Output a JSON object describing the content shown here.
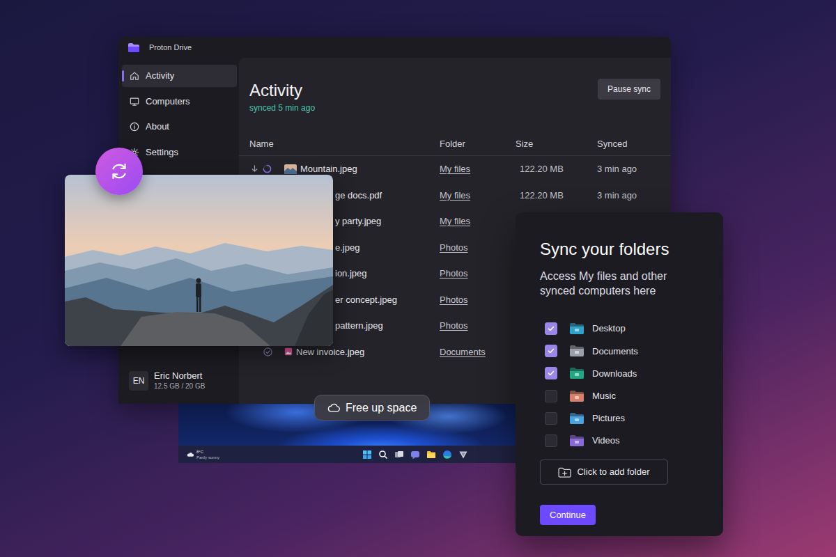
{
  "window": {
    "title": "Proton Drive"
  },
  "sidebar": {
    "items": [
      {
        "label": "Activity",
        "selected": true
      },
      {
        "label": "Computers",
        "selected": false
      },
      {
        "label": "About",
        "selected": false
      },
      {
        "label": "Settings",
        "selected": false
      }
    ],
    "user": {
      "initials": "EN",
      "name": "Eric Norbert",
      "storage": "12.5 GB / 20 GB"
    }
  },
  "activity": {
    "title": "Activity",
    "status": "synced 5 min ago",
    "pause_button": "Pause sync"
  },
  "table": {
    "columns": [
      "Name",
      "Folder",
      "Size",
      "Synced"
    ],
    "rows": [
      {
        "kind": "syncing",
        "name": "Mountain.jpeg",
        "folder": "My files",
        "size": "122.20 MB",
        "synced": "3 min ago"
      },
      {
        "kind": "covered",
        "name": "ge docs.pdf",
        "folder": "My files",
        "size": "122.20 MB",
        "synced": "3 min ago"
      },
      {
        "kind": "covered",
        "name": "y party.jpeg",
        "folder": "My files"
      },
      {
        "kind": "covered",
        "name": "e.jpeg",
        "folder": "Photos"
      },
      {
        "kind": "covered",
        "name": "ion.jpeg",
        "folder": "Photos"
      },
      {
        "kind": "covered",
        "name": "er concept.jpeg",
        "folder": "Photos"
      },
      {
        "kind": "covered",
        "name": "pattern.jpeg",
        "folder": "Photos"
      },
      {
        "kind": "synced",
        "name": "New invoice.jpeg",
        "folder": "Documents"
      }
    ]
  },
  "free_up": {
    "label": "Free up space"
  },
  "taskbar": {
    "temperature": "8°C",
    "weather": "Partly sunny"
  },
  "sync_dialog": {
    "title": "Sync your folders",
    "subtitle": "Access My files and other synced computers here",
    "folders": [
      {
        "label": "Desktop",
        "checked": true,
        "color": "#2fa3c9"
      },
      {
        "label": "Documents",
        "checked": true,
        "color": "#9aa0aa"
      },
      {
        "label": "Downloads",
        "checked": true,
        "color": "#22a884"
      },
      {
        "label": "Music",
        "checked": false,
        "color": "#d8806c"
      },
      {
        "label": "Pictures",
        "checked": false,
        "color": "#4aa3e0"
      },
      {
        "label": "Videos",
        "checked": false,
        "color": "#8a6ad8"
      }
    ],
    "add_folder": "Click to add folder",
    "continue": "Continue"
  }
}
